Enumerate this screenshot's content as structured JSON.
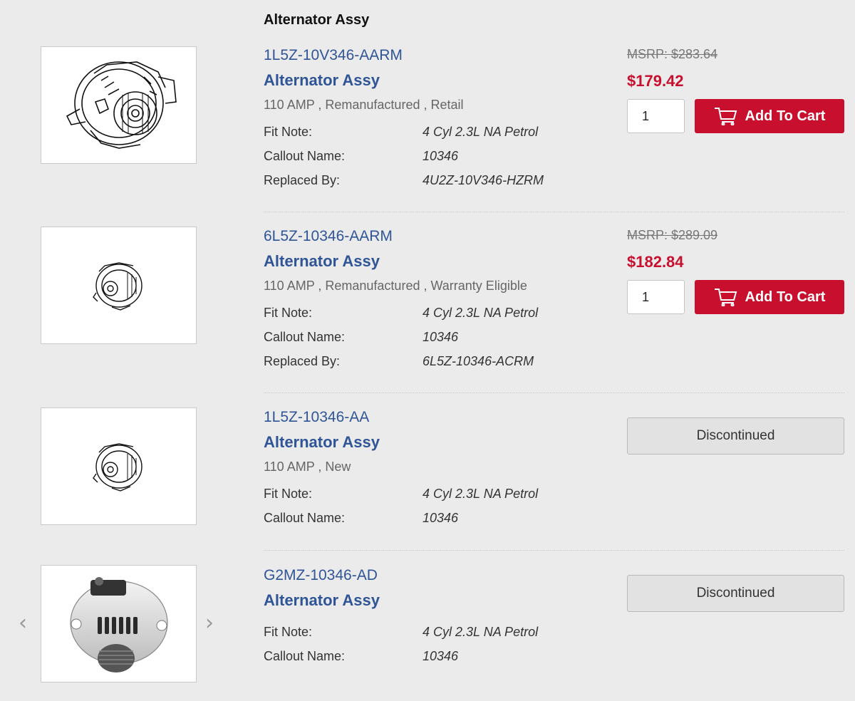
{
  "section_title": "Alternator Assy",
  "labels": {
    "fit_note": "Fit Note:",
    "callout_name": "Callout Name:",
    "replaced_by": "Replaced By:",
    "add_to_cart": "Add To Cart",
    "discontinued": "Discontinued"
  },
  "products": [
    {
      "part_number": "1L5Z-10V346-AARM",
      "name": "Alternator Assy",
      "description": "110 AMP , Remanufactured , Retail",
      "fit_note": "4 Cyl 2.3L NA Petrol",
      "callout_name": "10346",
      "replaced_by": "4U2Z-10V346-HZRM",
      "msrp": "MSRP: $283.64",
      "price": "$179.42",
      "quantity": "1",
      "image_icon": "alternator-line-drawing-icon"
    },
    {
      "part_number": "6L5Z-10346-AARM",
      "name": "Alternator Assy",
      "description": "110 AMP , Remanufactured , Warranty Eligible",
      "fit_note": "4 Cyl 2.3L NA Petrol",
      "callout_name": "10346",
      "replaced_by": "6L5Z-10346-ACRM",
      "msrp": "MSRP: $289.09",
      "price": "$182.84",
      "quantity": "1",
      "image_icon": "alternator-small-drawing-icon"
    },
    {
      "part_number": "1L5Z-10346-AA",
      "name": "Alternator Assy",
      "description": "110 AMP , New",
      "fit_note": "4 Cyl 2.3L NA Petrol",
      "callout_name": "10346",
      "status": "Discontinued",
      "image_icon": "alternator-small-drawing-icon"
    },
    {
      "part_number": "G2MZ-10346-AD",
      "name": "Alternator Assy",
      "fit_note": "4 Cyl 2.3L NA Petrol",
      "callout_name": "10346",
      "status": "Discontinued",
      "image_icon": "alternator-photo-icon"
    }
  ],
  "carousel": {
    "prev_icon": "chevron-left-icon",
    "next_icon": "chevron-right-icon"
  },
  "colors": {
    "link_blue": "#2f5597",
    "price_red": "#c8102e",
    "background": "#ebebeb"
  }
}
